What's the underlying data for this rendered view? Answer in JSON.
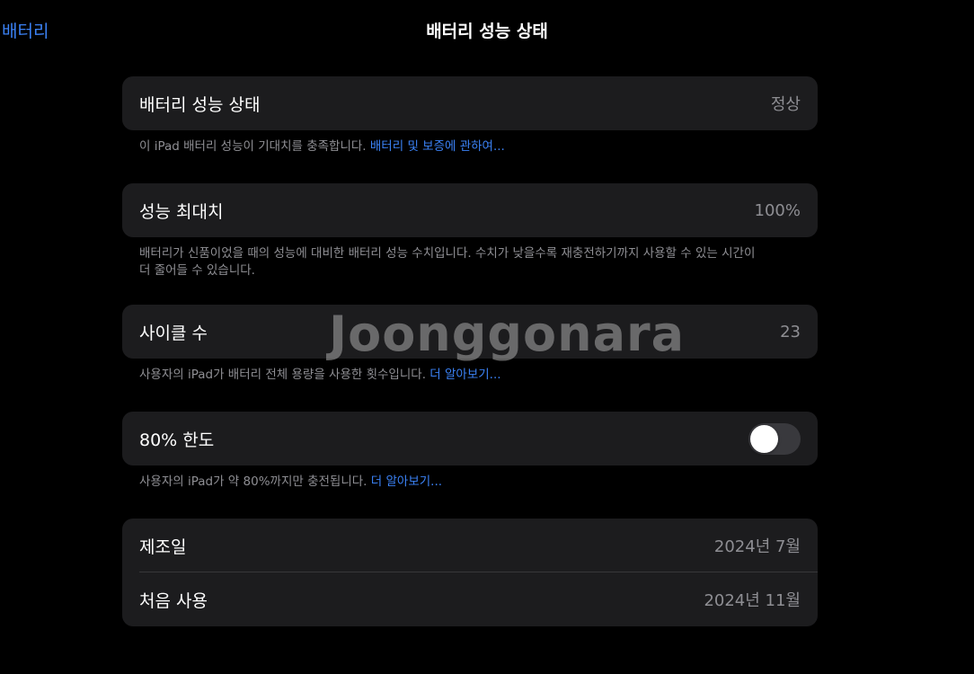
{
  "nav": {
    "back_label": "배터리",
    "title": "배터리 성능 상태"
  },
  "health": {
    "label": "배터리 성능 상태",
    "value": "정상",
    "footnote_text": "이 iPad 배터리 성능이 기대치를 충족합니다. ",
    "footnote_link": "배터리 및 보증에 관하여..."
  },
  "max_capacity": {
    "label": "성능 최대치",
    "value": "100%",
    "footnote_line1": "배터리가 신품이었을 때의 성능에 대비한 배터리 성능 수치입니다. 수치가 낮을수록 재충전하기까지 사용할 수 있는 시간이",
    "footnote_line2": "더 줄어들 수 있습니다."
  },
  "cycle_count": {
    "label": "사이클 수",
    "value": "23",
    "footnote_text": "사용자의 iPad가 배터리 전체 용량을 사용한 횟수입니다. ",
    "footnote_link": "더 알아보기..."
  },
  "limit_80": {
    "label": "80% 한도",
    "toggle_on": false,
    "footnote_text": "사용자의 iPad가 약 80%까지만 충전됩니다. ",
    "footnote_link": "더 알아보기..."
  },
  "dates": {
    "manufacture_label": "제조일",
    "manufacture_value": "2024년 7월",
    "first_use_label": "처음 사용",
    "first_use_value": "2024년 11월"
  },
  "watermark": {
    "text": "Joonggonara"
  },
  "colors": {
    "accent": "#3b82f6",
    "background": "#000000",
    "card": "#1c1c1e",
    "secondary_text": "#8e8e93"
  }
}
